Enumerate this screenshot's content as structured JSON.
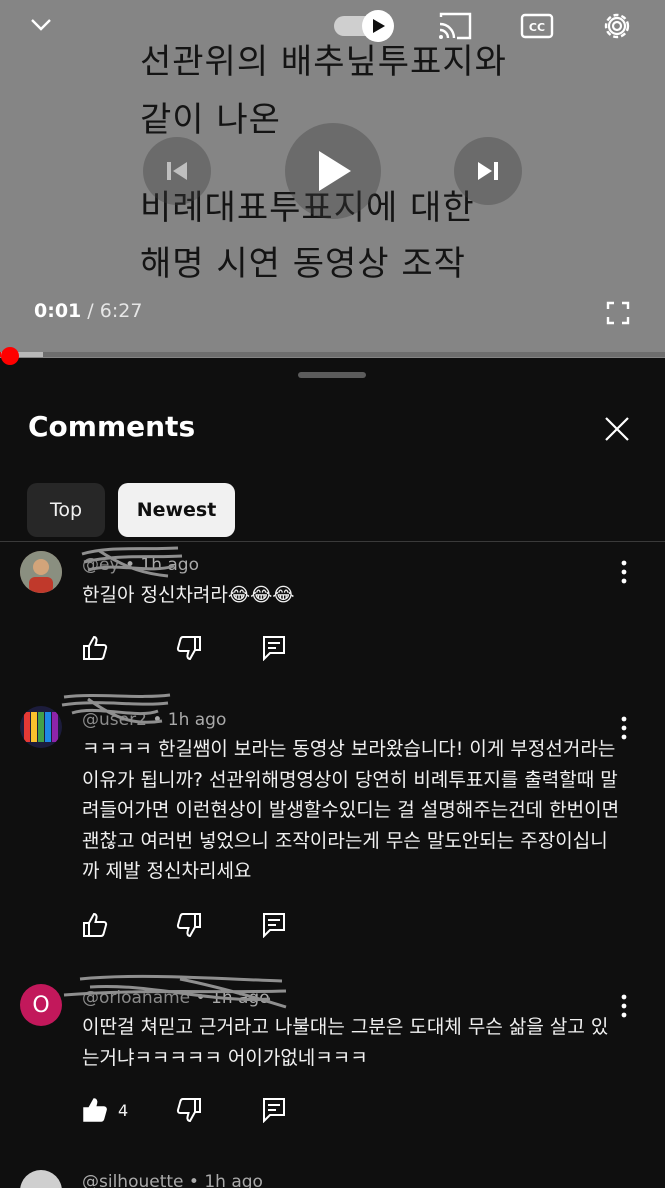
{
  "player": {
    "overlay_lines": [
      "선관위의 배추닢투표지와",
      "같이 나온",
      "비례대표투표지에 대한",
      "해명 시연 동영상 조작"
    ],
    "current_time": "0:01",
    "separator": " / ",
    "duration": "6:27",
    "progress_played_fraction": 0.002,
    "progress_buffered_fraction": 0.065,
    "autoplay_on": true
  },
  "sheet": {
    "title": "Comments",
    "sort_chips": [
      {
        "label": "Top",
        "selected": false
      },
      {
        "label": "Newest",
        "selected": true
      }
    ]
  },
  "comments": [
    {
      "author": "@ey",
      "time": "1h ago",
      "text": "한길아 정신차려라😂😂😂",
      "likes": "",
      "avatar_color": "#a0785a"
    },
    {
      "author": "@user2",
      "time": "1h ago",
      "text": "ㅋㅋㅋㅋ 한길쌤이 보라는 동영상 보라왔습니다! 이게 부정선거라는 이유가 됩니까? 선관위해명영상이 당연히 비례투표지를 출력할때 말려들어가면 이런현상이 발생할수있디는 걸 설명해주는건데 한번이면 괜찮고 여러번 넣었으니 조작이라는게 무슨 말도안되는 주장이십니까 제발 정신차리세요",
      "likes": "",
      "avatar_color": "#2a2a6a"
    },
    {
      "author": "@orloaname",
      "time": "1h ago",
      "text": "이딴걸 쳐믿고 근거라고 나불대는 그분은 도대체 무슨 삶을 살고 있는거냐ㅋㅋㅋㅋㅋ 어이가없네ㅋㅋㅋ",
      "likes": "4",
      "avatar_letter": "O",
      "avatar_color": "#c2185b"
    },
    {
      "author": "@silhouette",
      "time": "1h ago",
      "text": "",
      "likes": "",
      "avatar_color": "#cfcfcf"
    }
  ],
  "icons": {
    "collapse": "chevron-down-icon",
    "autoplay": "autoplay-toggle-icon",
    "cast": "cast-icon",
    "captions": "captions-icon",
    "settings": "gear-icon",
    "previous": "previous-icon",
    "play": "play-icon",
    "next": "next-icon",
    "fullscreen": "fullscreen-icon",
    "close": "close-icon",
    "like": "thumbs-up-icon",
    "dislike": "thumbs-down-icon",
    "reply": "reply-icon",
    "more": "more-vertical-icon"
  }
}
